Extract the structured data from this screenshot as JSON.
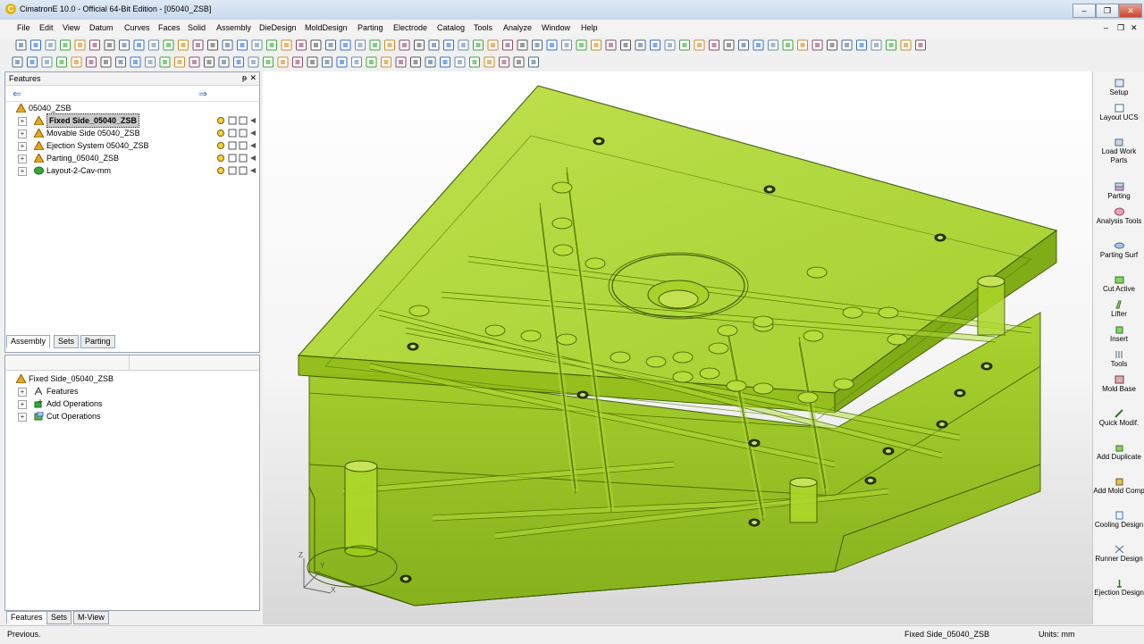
{
  "window": {
    "title": "CimatronE 10.0 - Official 64-Bit Edition - [05040_ZSB]",
    "app_icon": "C",
    "minimize": "–",
    "restore": "❐",
    "close": "✕",
    "mdi_min": "–",
    "mdi_restore": "❐",
    "mdi_close": "✕"
  },
  "menu": [
    "File",
    "Edit",
    "View",
    "Datum",
    "Curves",
    "Faces",
    "Solid",
    "Assembly",
    "DieDesign",
    "MoldDesign",
    "Parting",
    "Electrode",
    "Catalog",
    "Tools",
    "Analyze",
    "Window",
    "Help"
  ],
  "features_panel": {
    "title": "Features",
    "pin": "ᵽ",
    "close": "✕",
    "back_arrow": "⇐",
    "forward_arrow": "⇒",
    "root": "05040_ZSB",
    "items": [
      {
        "label": "Fixed Side_05040_ZSB",
        "expander": "+",
        "selected": true
      },
      {
        "label": "Movable Side 05040_ZSB",
        "expander": "+"
      },
      {
        "label": "Ejection System 05040_ZSB",
        "expander": "+"
      },
      {
        "label": "Parting_05040_ZSB",
        "expander": "+"
      },
      {
        "label": "Layout-2-Cav-mm",
        "expander": "+"
      }
    ],
    "tabs": [
      "Assembly",
      "Sets",
      "Parting"
    ],
    "active_tab": "Assembly"
  },
  "operations_panel": {
    "root": "Fixed Side_05040_ZSB",
    "items": [
      {
        "label": "Features",
        "expander": "+"
      },
      {
        "label": "Add Operations",
        "expander": "+"
      },
      {
        "label": "Cut Operations",
        "expander": "+"
      }
    ],
    "tabs": [
      "Features",
      "Sets",
      "M-View"
    ],
    "active_tab": "Features"
  },
  "right_toolbar": [
    {
      "label": "Setup",
      "icon": "setup-icon"
    },
    {
      "label": "Layout UCS",
      "icon": "layout-ucs-icon"
    },
    {
      "label": "Load Work Parts",
      "icon": "load-work-parts-icon"
    },
    {
      "label": "Parting",
      "icon": "parting-icon"
    },
    {
      "label": "Analysis Tools",
      "icon": "analysis-tools-icon"
    },
    {
      "label": "Parting Surf",
      "icon": "parting-surf-icon"
    },
    {
      "label": "Cut Active",
      "icon": "cut-active-icon"
    },
    {
      "label": "Lifter",
      "icon": "lifter-icon"
    },
    {
      "label": "Insert",
      "icon": "insert-icon"
    },
    {
      "label": "Tools",
      "icon": "tools-icon"
    },
    {
      "label": "Mold Base",
      "icon": "mold-base-icon"
    },
    {
      "label": "Quick Modif.",
      "icon": "quick-modif-icon"
    },
    {
      "label": "Add Duplicate",
      "icon": "add-duplicate-icon"
    },
    {
      "label": "Add Mold Comp",
      "icon": "add-mold-comp-icon"
    },
    {
      "label": "Cooling Design",
      "icon": "cooling-design-icon"
    },
    {
      "label": "Runner Design",
      "icon": "runner-design-icon"
    },
    {
      "label": "Ejection Design",
      "icon": "ejection-design-icon"
    }
  ],
  "axis": {
    "z": "Z",
    "x": "X",
    "y": "Y"
  },
  "status": {
    "left": "Previous.",
    "part": "Fixed Side_05040_ZSB",
    "units": "Units: mm"
  },
  "colors": {
    "model": "#9ccc1a",
    "model_dark": "#6f9a0a",
    "edge": "#3d5a00",
    "accent": "#2f6fd0"
  }
}
